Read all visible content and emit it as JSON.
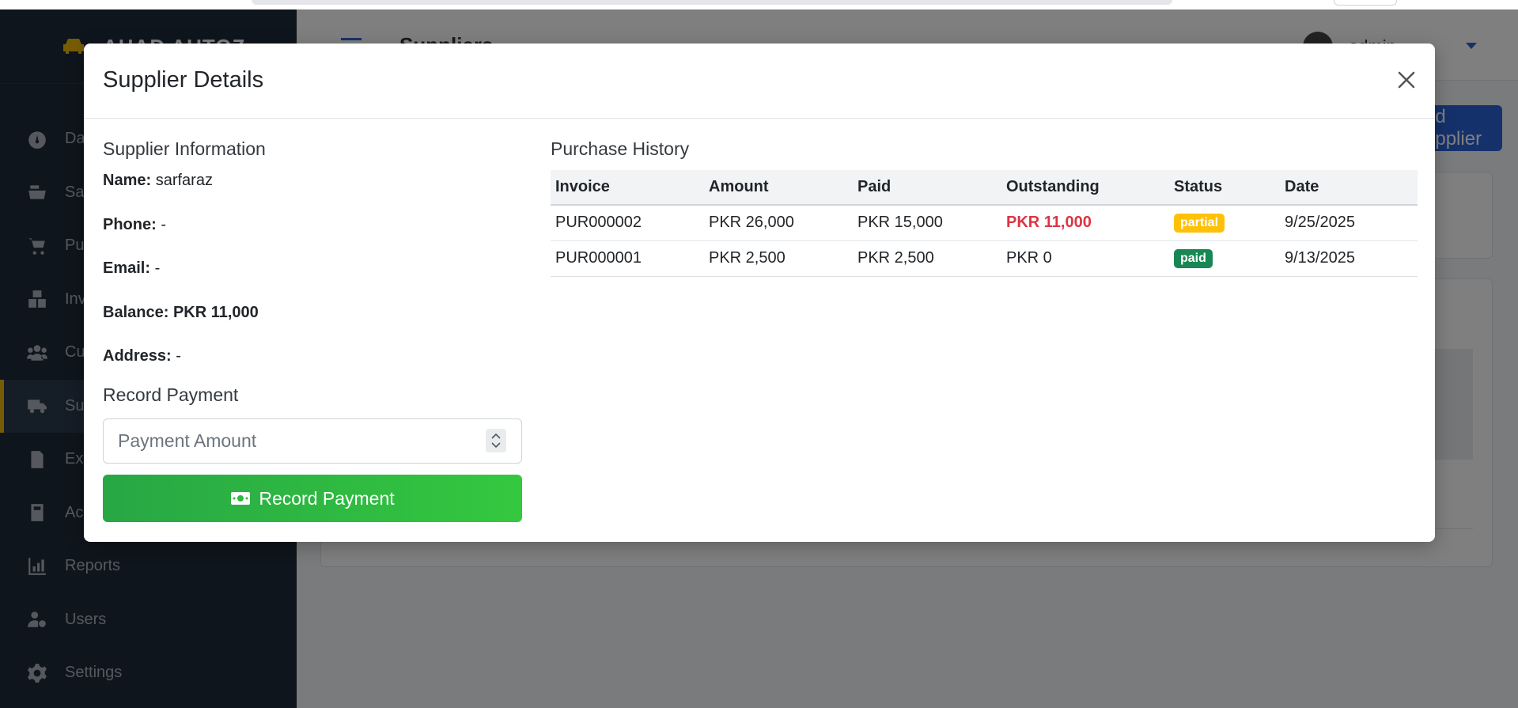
{
  "app": {
    "brand": "AHAD AUTOZ",
    "page_title": "Suppliers",
    "user_name": "admin",
    "add_button_label": "Add Supplier"
  },
  "sidebar": {
    "items": [
      {
        "label": "Dashboard",
        "icon": "gauge-icon"
      },
      {
        "label": "Sales",
        "icon": "cash-register-icon"
      },
      {
        "label": "Purchases",
        "icon": "cart-icon"
      },
      {
        "label": "Inventory",
        "icon": "boxes-icon"
      },
      {
        "label": "Customers",
        "icon": "users-icon"
      },
      {
        "label": "Suppliers",
        "icon": "truck-icon",
        "active": true
      },
      {
        "label": "Expenses",
        "icon": "receipt-dollar-icon"
      },
      {
        "label": "Accounts",
        "icon": "calculator-icon"
      },
      {
        "label": "Reports",
        "icon": "chart-bars-icon"
      },
      {
        "label": "Users",
        "icon": "user-gear-icon"
      },
      {
        "label": "Settings",
        "icon": "gear-icon"
      }
    ]
  },
  "modal": {
    "title": "Supplier Details",
    "supplier_info": {
      "heading": "Supplier Information",
      "name_label": "Name:",
      "name_value": "sarfaraz",
      "phone_label": "Phone:",
      "phone_value": "-",
      "email_label": "Email:",
      "email_value": "-",
      "balance_label": "Balance:",
      "balance_value": "PKR 11,000",
      "address_label": "Address:",
      "address_value": "-"
    },
    "record_payment": {
      "heading": "Record Payment",
      "input_placeholder": "Payment Amount",
      "input_value": "",
      "button_label": "Record Payment"
    },
    "purchase_history": {
      "heading": "Purchase History",
      "columns": [
        "Invoice",
        "Amount",
        "Paid",
        "Outstanding",
        "Status",
        "Date"
      ],
      "rows": [
        {
          "invoice": "PUR000002",
          "amount": "PKR 26,000",
          "paid": "PKR 15,000",
          "outstanding": "PKR 11,000",
          "status": "partial",
          "date": "9/25/2025"
        },
        {
          "invoice": "PUR000001",
          "amount": "PKR 2,500",
          "paid": "PKR 2,500",
          "outstanding": "PKR 0",
          "status": "paid",
          "date": "9/13/2025"
        }
      ]
    }
  },
  "colors": {
    "sidebar_bg": "#1e2a38",
    "accent": "#f0b90b",
    "primary": "#2a63d6",
    "success": "#28a745",
    "danger": "#dc3545",
    "warning": "#ffc107",
    "paid_badge": "#198754"
  }
}
